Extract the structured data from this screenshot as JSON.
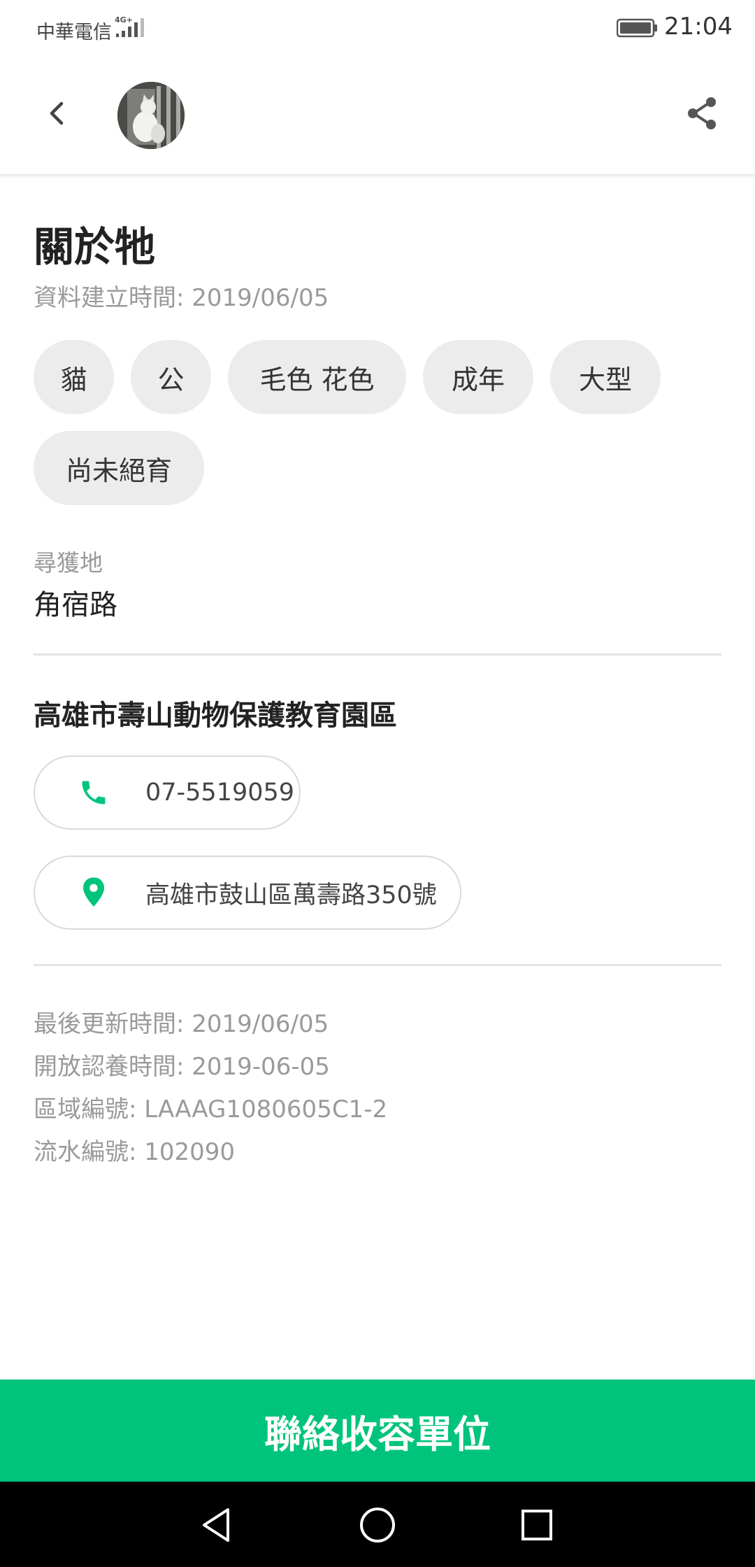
{
  "status_bar": {
    "carrier": "中華電信",
    "network": "4G+",
    "time": "21:04"
  },
  "header": {
    "back_icon": "chevron-left-icon",
    "share_icon": "share-icon"
  },
  "about": {
    "title": "關於牠",
    "created": "資料建立時間: 2019/06/05",
    "tags": [
      "貓",
      "公",
      "毛色 花色",
      "成年",
      "大型",
      "尚未絕育"
    ],
    "found_label": "尋獲地",
    "found_value": "角宿路"
  },
  "shelter": {
    "name": "高雄市壽山動物保護教育園區",
    "phone": "07-5519059",
    "address": "高雄市鼓山區萬壽路350號",
    "phone_icon": "phone-icon",
    "address_icon": "map-pin-icon",
    "accent_color": "#00c47c"
  },
  "meta": {
    "updated": "最後更新時間: 2019/06/05",
    "adoption_open": "開放認養時間: 2019-06-05",
    "area_id": "區域編號: LAAAG1080605C1-2",
    "serial": "流水編號: 102090"
  },
  "action": {
    "contact_label": "聯絡收容單位"
  },
  "nav": {
    "back": "nav-back-icon",
    "home": "nav-home-icon",
    "recents": "nav-recents-icon"
  }
}
